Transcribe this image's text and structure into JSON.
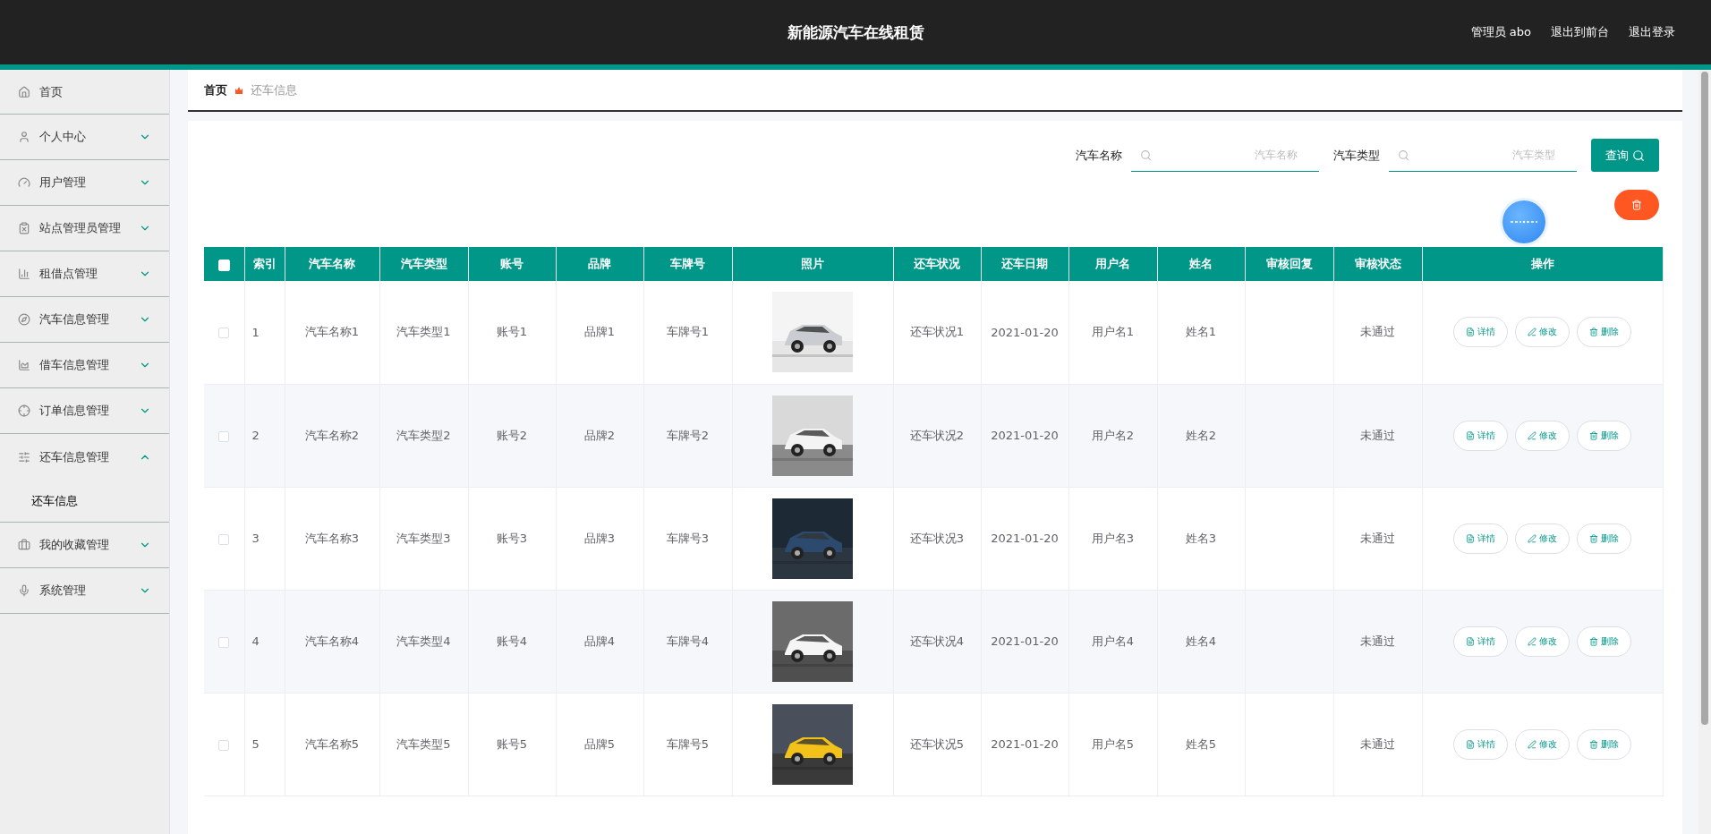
{
  "header": {
    "title": "新能源汽车在线租赁",
    "links": [
      "管理员 abo",
      "退出到前台",
      "退出登录"
    ]
  },
  "sidebar": {
    "items": [
      {
        "kind": "link",
        "label": "首页"
      },
      {
        "kind": "menu",
        "label": "个人中心",
        "expanded": false
      },
      {
        "kind": "menu",
        "label": "用户管理",
        "expanded": false
      },
      {
        "kind": "menu",
        "label": "站点管理员管理",
        "expanded": false
      },
      {
        "kind": "menu",
        "label": "租借点管理",
        "expanded": false
      },
      {
        "kind": "menu",
        "label": "汽车信息管理",
        "expanded": false
      },
      {
        "kind": "menu",
        "label": "借车信息管理",
        "expanded": false
      },
      {
        "kind": "menu",
        "label": "订单信息管理",
        "expanded": false
      },
      {
        "kind": "menu",
        "label": "还车信息管理",
        "expanded": true,
        "children": [
          {
            "label": "还车信息",
            "selected": true
          }
        ]
      },
      {
        "kind": "menu",
        "label": "我的收藏管理",
        "expanded": false
      },
      {
        "kind": "menu",
        "label": "系统管理",
        "expanded": false
      }
    ]
  },
  "breadcrumb": [
    "首页",
    "还车信息"
  ],
  "search": {
    "fields": [
      {
        "label": "汽车名称",
        "placeholder": "汽车名称"
      },
      {
        "label": "汽车类型",
        "placeholder": "汽车类型"
      }
    ],
    "button": "查询"
  },
  "table": {
    "all_selected": false,
    "columns": [
      "索引",
      "汽车名称",
      "汽车类型",
      "账号",
      "品牌",
      "车牌号",
      "照片",
      "还车状况",
      "还车日期",
      "用户名",
      "姓名",
      "审核回复",
      "审核状态",
      "操作"
    ],
    "rows": [
      {
        "selected": false,
        "index": "1",
        "car_name": "汽车名称1",
        "car_type": "汽车类型1",
        "account": "账号1",
        "brand": "品牌1",
        "plate": "车牌号1",
        "return_status": "还车状况1",
        "date": "2021-01-20",
        "username": "用户名1",
        "name": "姓名1",
        "review_status": "未通过",
        "actions": [
          "详情",
          "修改",
          "删除"
        ]
      },
      {
        "selected": false,
        "index": "2",
        "car_name": "汽车名称2",
        "car_type": "汽车类型2",
        "account": "账号2",
        "brand": "品牌2",
        "plate": "车牌号2",
        "return_status": "还车状况2",
        "date": "2021-01-20",
        "username": "用户名2",
        "name": "姓名2",
        "review_status": "未通过",
        "actions": [
          "详情",
          "修改",
          "删除"
        ]
      },
      {
        "selected": false,
        "index": "3",
        "car_name": "汽车名称3",
        "car_type": "汽车类型3",
        "account": "账号3",
        "brand": "品牌3",
        "plate": "车牌号3",
        "return_status": "还车状况3",
        "date": "2021-01-20",
        "username": "用户名3",
        "name": "姓名3",
        "review_status": "未通过",
        "actions": [
          "详情",
          "修改",
          "删除"
        ]
      },
      {
        "selected": false,
        "index": "4",
        "car_name": "汽车名称4",
        "car_type": "汽车类型4",
        "account": "账号4",
        "brand": "品牌4",
        "plate": "车牌号4",
        "return_status": "还车状况4",
        "date": "2021-01-20",
        "username": "用户名4",
        "name": "姓名4",
        "review_status": "未通过",
        "actions": [
          "详情",
          "修改",
          "删除"
        ]
      },
      {
        "selected": false,
        "index": "5",
        "car_name": "汽车名称5",
        "car_type": "汽车类型5",
        "account": "账号5",
        "brand": "品牌5",
        "plate": "车牌号5",
        "return_status": "还车状况5",
        "date": "2021-01-20",
        "username": "用户名5",
        "name": "姓名5",
        "review_status": "未通过",
        "actions": [
          "详情",
          "修改",
          "删除"
        ]
      }
    ]
  }
}
